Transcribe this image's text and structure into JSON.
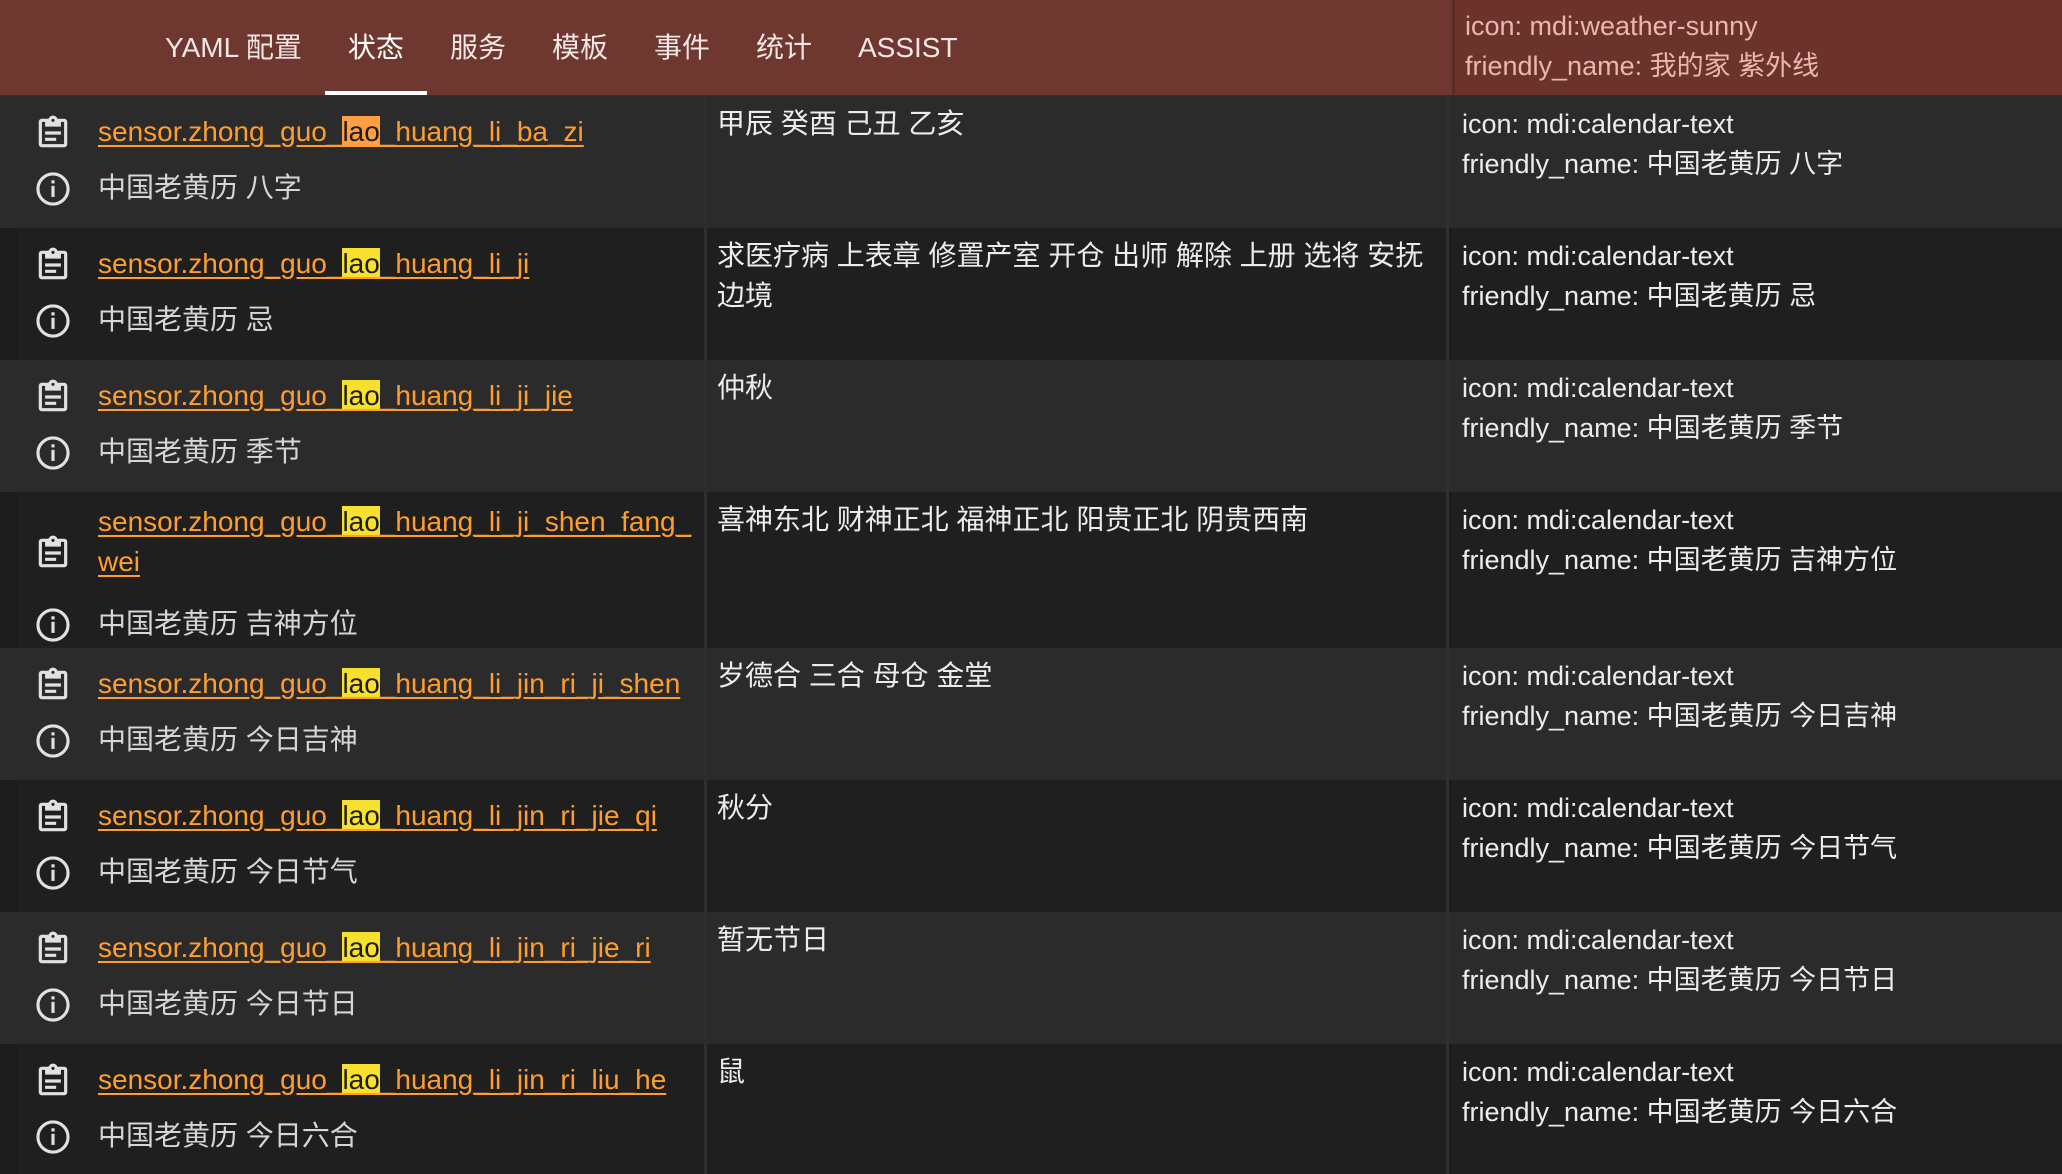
{
  "tabs": [
    {
      "label": "YAML 配置",
      "active": false
    },
    {
      "label": "状态",
      "active": true
    },
    {
      "label": "服务",
      "active": false
    },
    {
      "label": "模板",
      "active": false
    },
    {
      "label": "事件",
      "active": false
    },
    {
      "label": "统计",
      "active": false
    },
    {
      "label": "ASSIST",
      "active": false
    }
  ],
  "top_row_attributes": {
    "icon": "icon: mdi:weather-sunny",
    "friendly_name": "friendly_name: 我的家 紫外线"
  },
  "search_highlight": "lao",
  "colors": {
    "topbar": "#6e3730",
    "entity_link": "#ff9e2e",
    "highlight": "#f7e02e",
    "highlight_current": "#ff9f43"
  },
  "icons": {
    "copy": "clipboard-text-icon",
    "info": "information-outline-icon"
  },
  "rows": [
    {
      "entity_pre": "sensor.zhong_guo_",
      "entity_match": "lao",
      "entity_post": "_huang_li_ba_zi",
      "friendly_name": "中国老黄历 八字",
      "state": "甲辰 癸酉 己丑 乙亥",
      "attr_icon": "icon: mdi:calendar-text",
      "attr_friendly": "friendly_name: 中国老黄历 八字"
    },
    {
      "entity_pre": "sensor.zhong_guo_",
      "entity_match": "lao",
      "entity_post": "_huang_li_ji",
      "friendly_name": "中国老黄历 忌",
      "state": "求医疗病 上表章 修置产室 开仓 出师 解除 上册 选将 安抚边境",
      "attr_icon": "icon: mdi:calendar-text",
      "attr_friendly": "friendly_name: 中国老黄历 忌"
    },
    {
      "entity_pre": "sensor.zhong_guo_",
      "entity_match": "lao",
      "entity_post": "_huang_li_ji_jie",
      "friendly_name": "中国老黄历 季节",
      "state": "仲秋",
      "attr_icon": "icon: mdi:calendar-text",
      "attr_friendly": "friendly_name: 中国老黄历 季节"
    },
    {
      "entity_pre": "sensor.zhong_guo_",
      "entity_match": "lao",
      "entity_post": "_huang_li_ji_shen_fang_wei",
      "friendly_name": "中国老黄历 吉神方位",
      "state": "喜神东北 财神正北 福神正北 阳贵正北 阴贵西南",
      "attr_icon": "icon: mdi:calendar-text",
      "attr_friendly": "friendly_name: 中国老黄历 吉神方位"
    },
    {
      "entity_pre": "sensor.zhong_guo_",
      "entity_match": "lao",
      "entity_post": "_huang_li_jin_ri_ji_shen",
      "friendly_name": "中国老黄历 今日吉神",
      "state": "岁德合 三合 母仓 金堂",
      "attr_icon": "icon: mdi:calendar-text",
      "attr_friendly": "friendly_name: 中国老黄历 今日吉神"
    },
    {
      "entity_pre": "sensor.zhong_guo_",
      "entity_match": "lao",
      "entity_post": "_huang_li_jin_ri_jie_qi",
      "friendly_name": "中国老黄历 今日节气",
      "state": "秋分",
      "attr_icon": "icon: mdi:calendar-text",
      "attr_friendly": "friendly_name: 中国老黄历 今日节气"
    },
    {
      "entity_pre": "sensor.zhong_guo_",
      "entity_match": "lao",
      "entity_post": "_huang_li_jin_ri_jie_ri",
      "friendly_name": "中国老黄历 今日节日",
      "state": "暂无节日",
      "attr_icon": "icon: mdi:calendar-text",
      "attr_friendly": "friendly_name: 中国老黄历 今日节日"
    },
    {
      "entity_pre": "sensor.zhong_guo_",
      "entity_match": "lao",
      "entity_post": "_huang_li_jin_ri_liu_he",
      "friendly_name": "中国老黄历 今日六合",
      "state": "鼠",
      "attr_icon": "icon: mdi:calendar-text",
      "attr_friendly": "friendly_name: 中国老黄历 今日六合"
    }
  ]
}
